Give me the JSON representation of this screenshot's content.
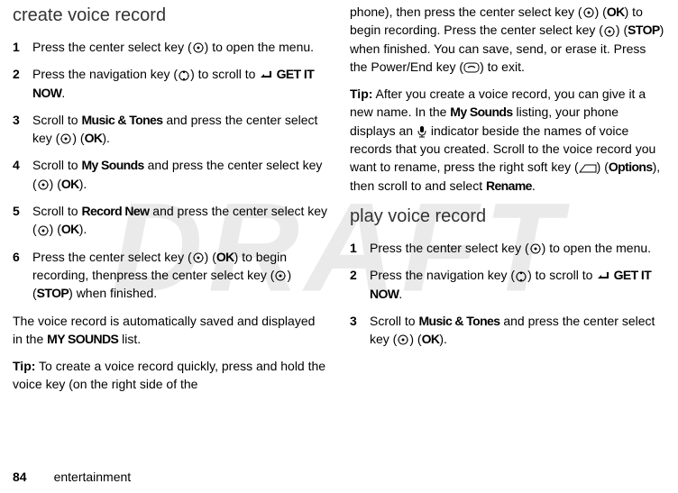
{
  "watermark": "DRAFT",
  "left": {
    "heading": "create voice record",
    "steps": [
      {
        "n": "1",
        "before": "Press the center select key (",
        "after": ") to open the menu."
      },
      {
        "n": "2",
        "before": "Press the navigation key (",
        "after": ") to scroll to ",
        "tail": " GET IT NOW",
        "tail2": "."
      },
      {
        "n": "3",
        "before": "Scroll to ",
        "bold1": "Music & Tones",
        "mid": " and press the center select key (",
        "after": ") (",
        "bold2": "OK",
        "tail": ")."
      },
      {
        "n": "4",
        "before": "Scroll to ",
        "bold1": "My Sounds",
        "mid": " and press the center select key (",
        "after": ") (",
        "bold2": "OK",
        "tail": ")."
      },
      {
        "n": "5",
        "before": "Scroll to ",
        "bold1": "Record New",
        "mid": " and press the center select key (",
        "after": ") (",
        "bold2": "OK",
        "tail": ")."
      },
      {
        "n": "6",
        "before": "Press the center select key (",
        "after": ") (",
        "bold1": "OK",
        "mid2": ") to begin recording, thenpress the center select key (",
        "after2": ") (",
        "bold2": "STOP",
        "tail": ") when finished."
      }
    ],
    "para1_a": "The voice record is automatically saved and displayed in the ",
    "para1_b": "MY SOUNDS",
    "para1_c": " list.",
    "tip_label": "Tip:",
    "tip_text": " To create a voice record quickly, press and hold the voice key (on the right side of the "
  },
  "right": {
    "cont_a": "phone), then press the center select key (",
    "cont_b": ") (",
    "cont_ok": "OK",
    "cont_c": ") to begin recording. Press the center select key (",
    "cont_d": ") (",
    "cont_stop": "STOP",
    "cont_e": ") when finished. You can save, send, or erase it. Press the Power/End key (",
    "cont_f": ") to exit.",
    "tip_label": "Tip:",
    "tip2_a": " After you create a voice record, you can give it a new name. In the ",
    "tip2_b": "My Sounds",
    "tip2_c": " listing, your phone displays an ",
    "tip2_d": " indicator beside the names of voice records that you created. Scroll to the voice record you want to rename, press the right soft key (",
    "tip2_e": ") (",
    "tip2_opt": "Options",
    "tip2_f": "), then scroll to and select ",
    "tip2_g": "Rename",
    "tip2_h": ".",
    "heading": "play voice record",
    "steps": [
      {
        "n": "1",
        "before": "Press the center select key (",
        "after": ") to open the menu."
      },
      {
        "n": "2",
        "before": "Press the navigation key (",
        "after": ") to scroll to ",
        "tail": " GET IT NOW",
        "tail2": "."
      },
      {
        "n": "3",
        "before": "Scroll to ",
        "bold1": "Music & Tones",
        "mid": " and press the center select key (",
        "after": ") (",
        "bold2": "OK",
        "tail": ")."
      }
    ]
  },
  "footer": {
    "page": "84",
    "section": "entertainment"
  }
}
